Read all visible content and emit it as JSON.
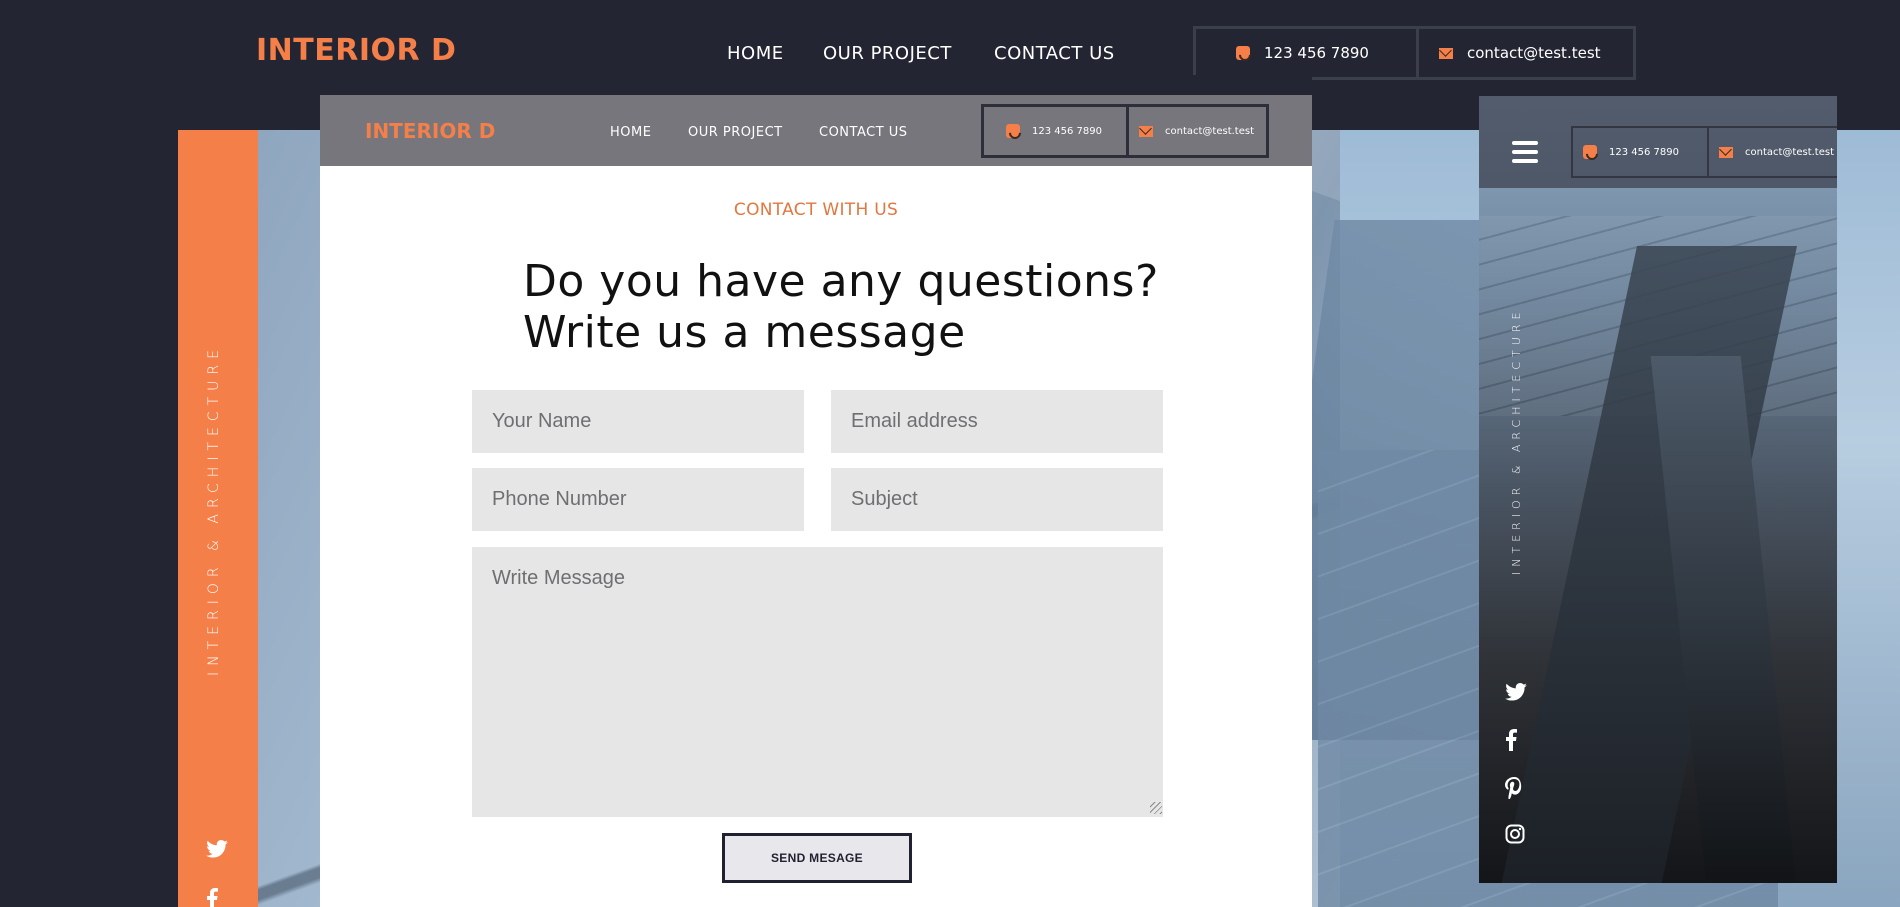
{
  "top": {
    "logo": "INTERIOR D",
    "nav": [
      "HOME",
      "OUR PROJECT",
      "CONTACT US"
    ],
    "phone": "123 456 7890",
    "email": "contact@test.test"
  },
  "side": {
    "tagline": "INTERIOR & ARCHITECTURE",
    "social": [
      "twitter-icon",
      "facebook-icon"
    ]
  },
  "card": {
    "logo": "INTERIOR D",
    "nav": [
      "HOME",
      "OUR PROJECT",
      "CONTACT US"
    ],
    "phone": "123 456 7890",
    "email": "contact@test.test",
    "eyebrow": "CONTACT WITH US",
    "headline_line1": "Do you have any questions?",
    "headline_line2": "Write us a message",
    "form": {
      "name_placeholder": "Your Name",
      "email_placeholder": "Email address",
      "phone_placeholder": "Phone Number",
      "subject_placeholder": "Subject",
      "message_placeholder": "Write Message",
      "submit_label": "SEND MESAGE"
    }
  },
  "mobile": {
    "phone": "123 456 7890",
    "email": "contact@test.test",
    "tagline": "INTERIOR & ARCHITECTURE",
    "social": [
      "twitter-icon",
      "facebook-icon",
      "pinterest-icon",
      "instagram-icon"
    ]
  },
  "colors": {
    "accent": "#f47f48",
    "dark": "#232532",
    "header_gray": "#76767c",
    "field_bg": "#e6e6e7"
  }
}
